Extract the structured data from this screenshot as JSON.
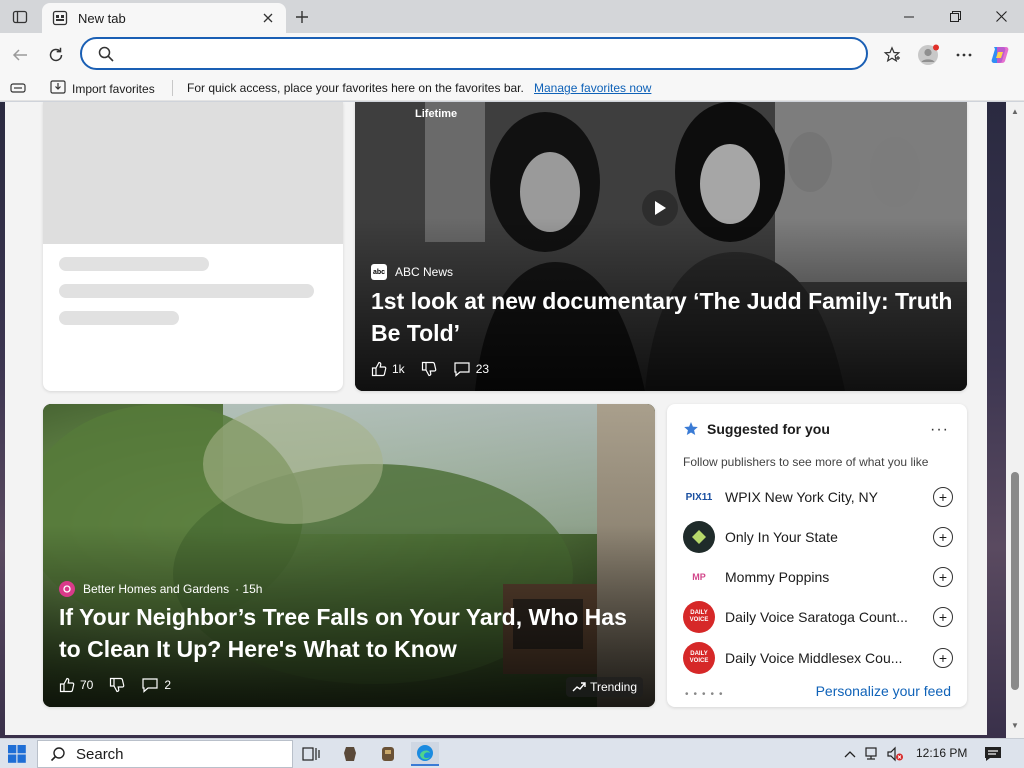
{
  "browser": {
    "tab_title": "New tab",
    "address_placeholder": ""
  },
  "favorites_bar": {
    "import_label": "Import favorites",
    "message": "For quick access, place your favorites here on the favorites bar.",
    "manage_link": "Manage favorites now"
  },
  "feed": {
    "video_card": {
      "overlay_label": "Lifetime",
      "publisher": "ABC News",
      "publisher_logo_text": "abc",
      "headline": "1st look at new documentary ‘The Judd Family: Truth Be Told’",
      "likes": "1k",
      "comments": "23"
    },
    "trending_card": {
      "publisher": "Better Homes and Gardens",
      "age": "· 15h",
      "headline": "If Your Neighbor’s Tree Falls on Your Yard, Who Has to Clean It Up? Here's What to Know",
      "likes": "70",
      "comments": "2",
      "badge": "Trending"
    },
    "suggested": {
      "title": "Suggested for you",
      "subtitle": "Follow publishers to see more of what you like",
      "publishers": [
        {
          "name": "WPIX New York City, NY",
          "logo": "PIX11",
          "color": "#ffffff"
        },
        {
          "name": "Only In Your State",
          "logo": "",
          "color": "#1f2b2a"
        },
        {
          "name": "Mommy Poppins",
          "logo": "MP",
          "color": "#ffffff"
        },
        {
          "name": "Daily Voice Saratoga Count...",
          "logo": "DAILY VOICE",
          "color": "#d62828"
        },
        {
          "name": "Daily Voice Middlesex Cou...",
          "logo": "DAILY VOICE",
          "color": "#d62828"
        }
      ],
      "personalize": "Personalize your feed"
    }
  },
  "taskbar": {
    "search_label": "Search",
    "time": "12:16 PM"
  },
  "colors": {
    "accent": "#1a5fb4",
    "link": "#0f62b8"
  }
}
